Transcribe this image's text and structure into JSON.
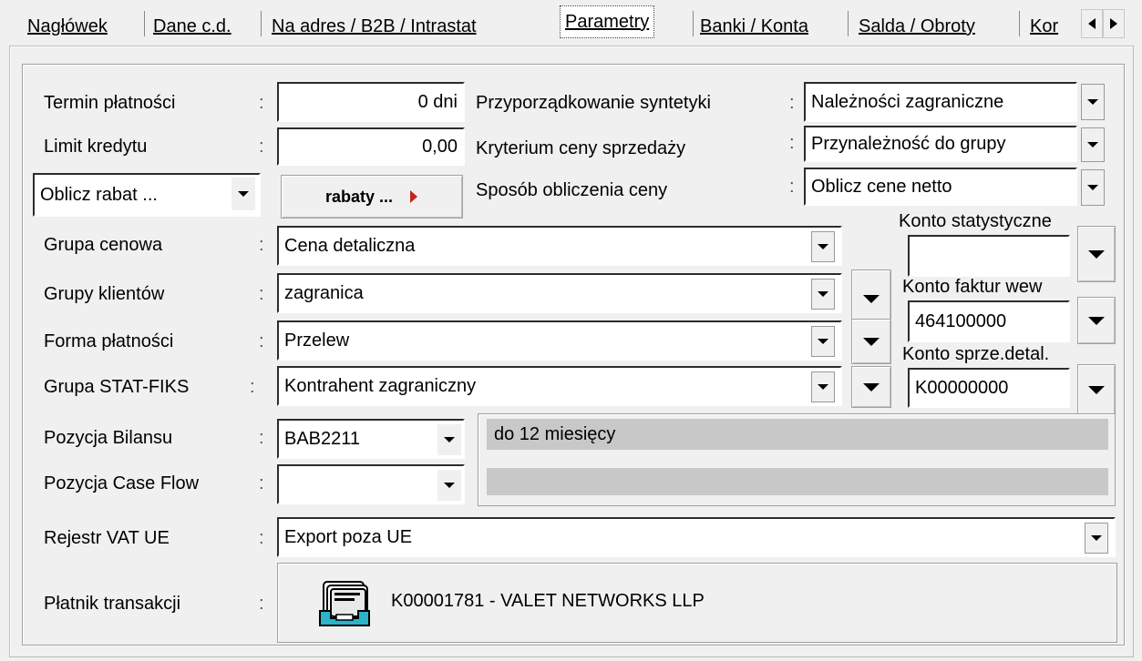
{
  "tabs": [
    {
      "label": "Nagłówek"
    },
    {
      "label": "Dane c.d."
    },
    {
      "label": "Na adres / B2B / Intrastat"
    },
    {
      "label": "Parametry"
    },
    {
      "label": "Banki / Konta"
    },
    {
      "label": "Salda / Obroty"
    },
    {
      "label": "Kor"
    }
  ],
  "termin": {
    "label": "Termin płatności",
    "value": "0 dni"
  },
  "limit": {
    "label": "Limit kredytu",
    "value": "0,00"
  },
  "rabat": {
    "select": "Oblicz rabat ...",
    "button": "rabaty  ..."
  },
  "syntetyka": {
    "label": "Przyporządkowanie syntetyki",
    "value": "Należności zagraniczne"
  },
  "kryterium": {
    "label": "Kryterium ceny sprzedaży",
    "value": "Przynależność do grupy"
  },
  "sposob": {
    "label": "Sposób obliczenia ceny",
    "value": "Oblicz cene netto"
  },
  "grupa_cenowa": {
    "label": "Grupa cenowa",
    "value": "Cena detaliczna"
  },
  "grupy_klientow": {
    "label": "Grupy klientów",
    "value": "zagranica"
  },
  "forma_platnosci": {
    "label": "Forma płatności",
    "value": "Przelew"
  },
  "grupa_stat": {
    "label": "Grupa  STAT-FIKS",
    "value": "Kontrahent zagraniczny"
  },
  "konto_stat": {
    "label": "Konto statystyczne",
    "value": ""
  },
  "konto_faktur": {
    "label": "Konto  faktur wew",
    "value": "464100000"
  },
  "konto_sprze": {
    "label": "Konto sprze.detal.",
    "value": "K00000000"
  },
  "pozycja_bilansu": {
    "label": "Pozycja Bilansu",
    "value": "BAB2211",
    "desc": "do 12 miesięcy"
  },
  "pozycja_case": {
    "label": "Pozycja Case Flow",
    "value": "",
    "desc": ""
  },
  "rejestr_vat": {
    "label": "Rejestr VAT UE",
    "value": "Export poza UE"
  },
  "platnik": {
    "label": "Płatnik  transakcji",
    "value": "K00001781 - VALET NETWORKS LLP"
  },
  "colon": ":"
}
